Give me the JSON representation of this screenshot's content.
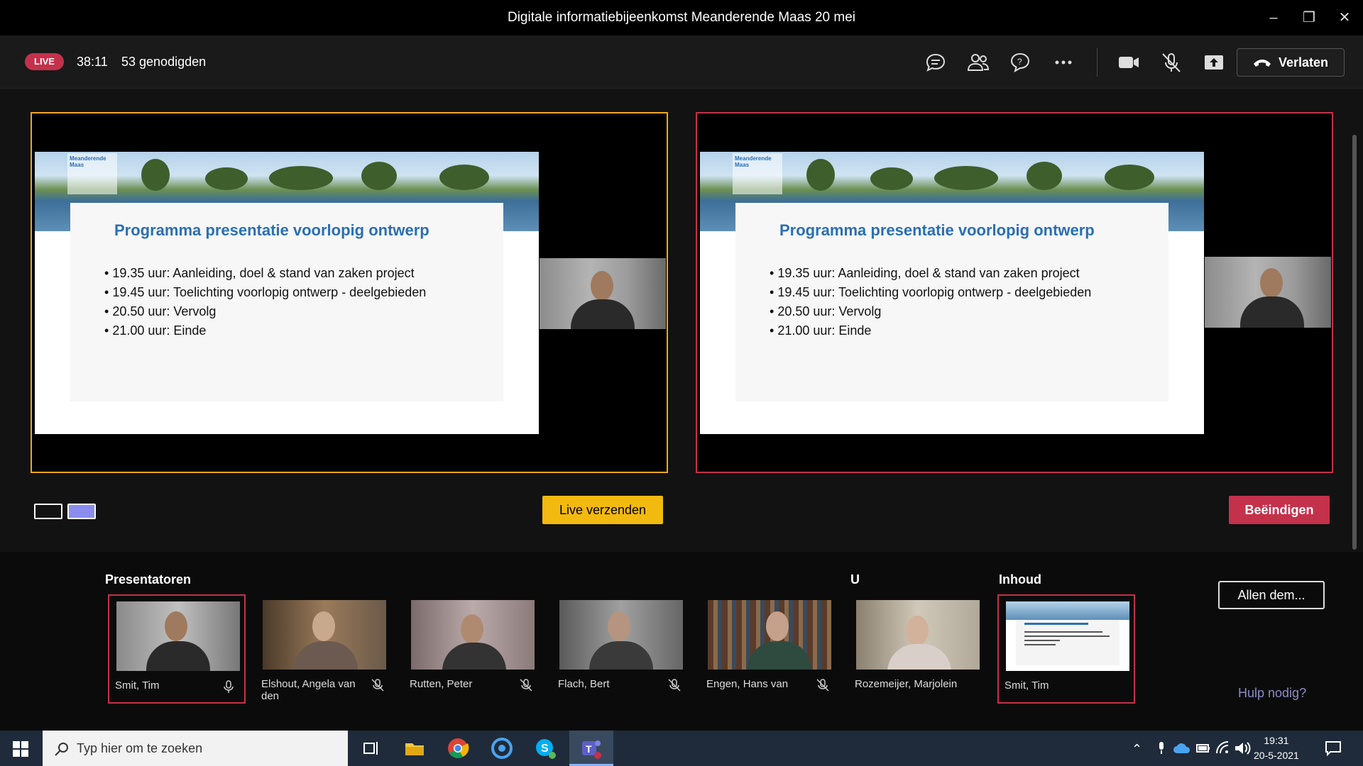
{
  "window": {
    "title": "Digitale informatiebijeenkomst Meanderende Maas 20 mei"
  },
  "toolbar": {
    "live_badge": "LIVE",
    "elapsed": "38:11",
    "invitees": "53 genodigden",
    "leave_label": "Verlaten",
    "icons": [
      "chat-icon",
      "participants-icon",
      "qna-icon",
      "more-icon",
      "camera-icon",
      "mic-muted-icon",
      "share-icon"
    ]
  },
  "slide": {
    "logo_line1": "Meanderende",
    "logo_line2": "Maas",
    "title": "Programma presentatie voorlopig ontwerp",
    "items": [
      "19.35 uur: Aanleiding, doel & stand van zaken project",
      "19.45 uur: Toelichting voorlopig ontwerp - deelgebieden",
      "20.50 uur: Vervolg",
      "21.00 uur: Einde"
    ]
  },
  "controls": {
    "send_live": "Live verzenden",
    "end": "Beëindigen"
  },
  "sections": {
    "presenters": "Presentatoren",
    "you": "U",
    "content": "Inhoud"
  },
  "participants": [
    {
      "name": "Smit, Tim"
    },
    {
      "name": "Elshout, Angela van den"
    },
    {
      "name": "Rutten, Peter"
    },
    {
      "name": "Flach, Bert"
    },
    {
      "name": "Engen, Hans van"
    },
    {
      "name": "Rozemeijer, Marjolein"
    }
  ],
  "content_tile": {
    "name": "Smit, Tim"
  },
  "mute_all": "Allen dem...",
  "help": "Hulp nodig?",
  "taskbar": {
    "search_placeholder": "Typ hier om te zoeken",
    "time": "19:31",
    "date": "20-5-2021"
  },
  "colors": {
    "live_red": "#c4314b",
    "queue_orange": "#f2a71b",
    "send_yellow": "#f2b90f",
    "accent_purple": "#8b8cc7"
  }
}
